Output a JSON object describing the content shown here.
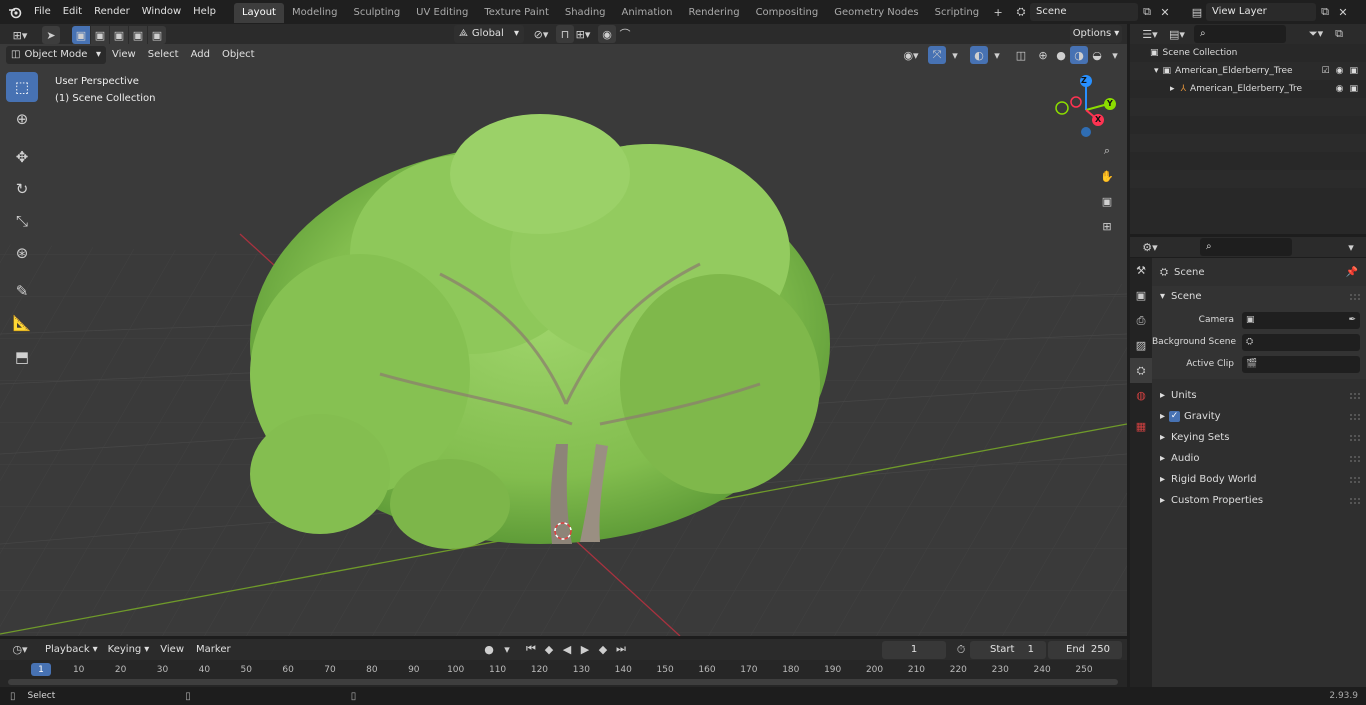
{
  "topbar": {
    "menu": [
      "File",
      "Edit",
      "Render",
      "Window",
      "Help"
    ],
    "workspaces": [
      "Layout",
      "Modeling",
      "Sculpting",
      "UV Editing",
      "Texture Paint",
      "Shading",
      "Animation",
      "Rendering",
      "Compositing",
      "Geometry Nodes",
      "Scripting"
    ],
    "active_workspace": "Layout",
    "scene_value": "Scene",
    "view_layer_value": "View Layer"
  },
  "viewport_header": {
    "mode": "Object Mode",
    "menus": [
      "View",
      "Select",
      "Add",
      "Object"
    ],
    "orientation": "Global",
    "options_label": "Options"
  },
  "viewport": {
    "perspective_label": "User Perspective",
    "collection_label": "(1) Scene Collection",
    "gizmo_axes": {
      "x": "X",
      "y": "Y",
      "z": "Z"
    }
  },
  "outliner": {
    "root": "Scene Collection",
    "collection": "American_Elderberry_Tree",
    "object": "American_Elderberry_Tre"
  },
  "properties": {
    "context_title": "Scene",
    "section": "Scene",
    "camera_label": "Camera",
    "background_scene_label": "Background Scene",
    "active_clip_label": "Active Clip",
    "panels": [
      "Units",
      "Gravity",
      "Keying Sets",
      "Audio",
      "Rigid Body World",
      "Custom Properties"
    ]
  },
  "timeline": {
    "menus": [
      "Playback",
      "Keying",
      "View",
      "Marker"
    ],
    "current_frame": "1",
    "start_label": "Start",
    "start_value": "1",
    "end_label": "End",
    "end_value": "250",
    "ruler": [
      "1",
      "10",
      "20",
      "30",
      "40",
      "50",
      "60",
      "70",
      "80",
      "90",
      "100",
      "110",
      "120",
      "130",
      "140",
      "150",
      "160",
      "170",
      "180",
      "190",
      "200",
      "210",
      "220",
      "230",
      "240",
      "250"
    ]
  },
  "statusbar": {
    "select_label": "Select",
    "version": "2.93.9"
  },
  "colors": {
    "accent": "#4772b3",
    "axis_x": "#ff3352",
    "axis_y": "#8bdc00",
    "axis_z": "#2890ff",
    "foliage": "#8ac653"
  }
}
